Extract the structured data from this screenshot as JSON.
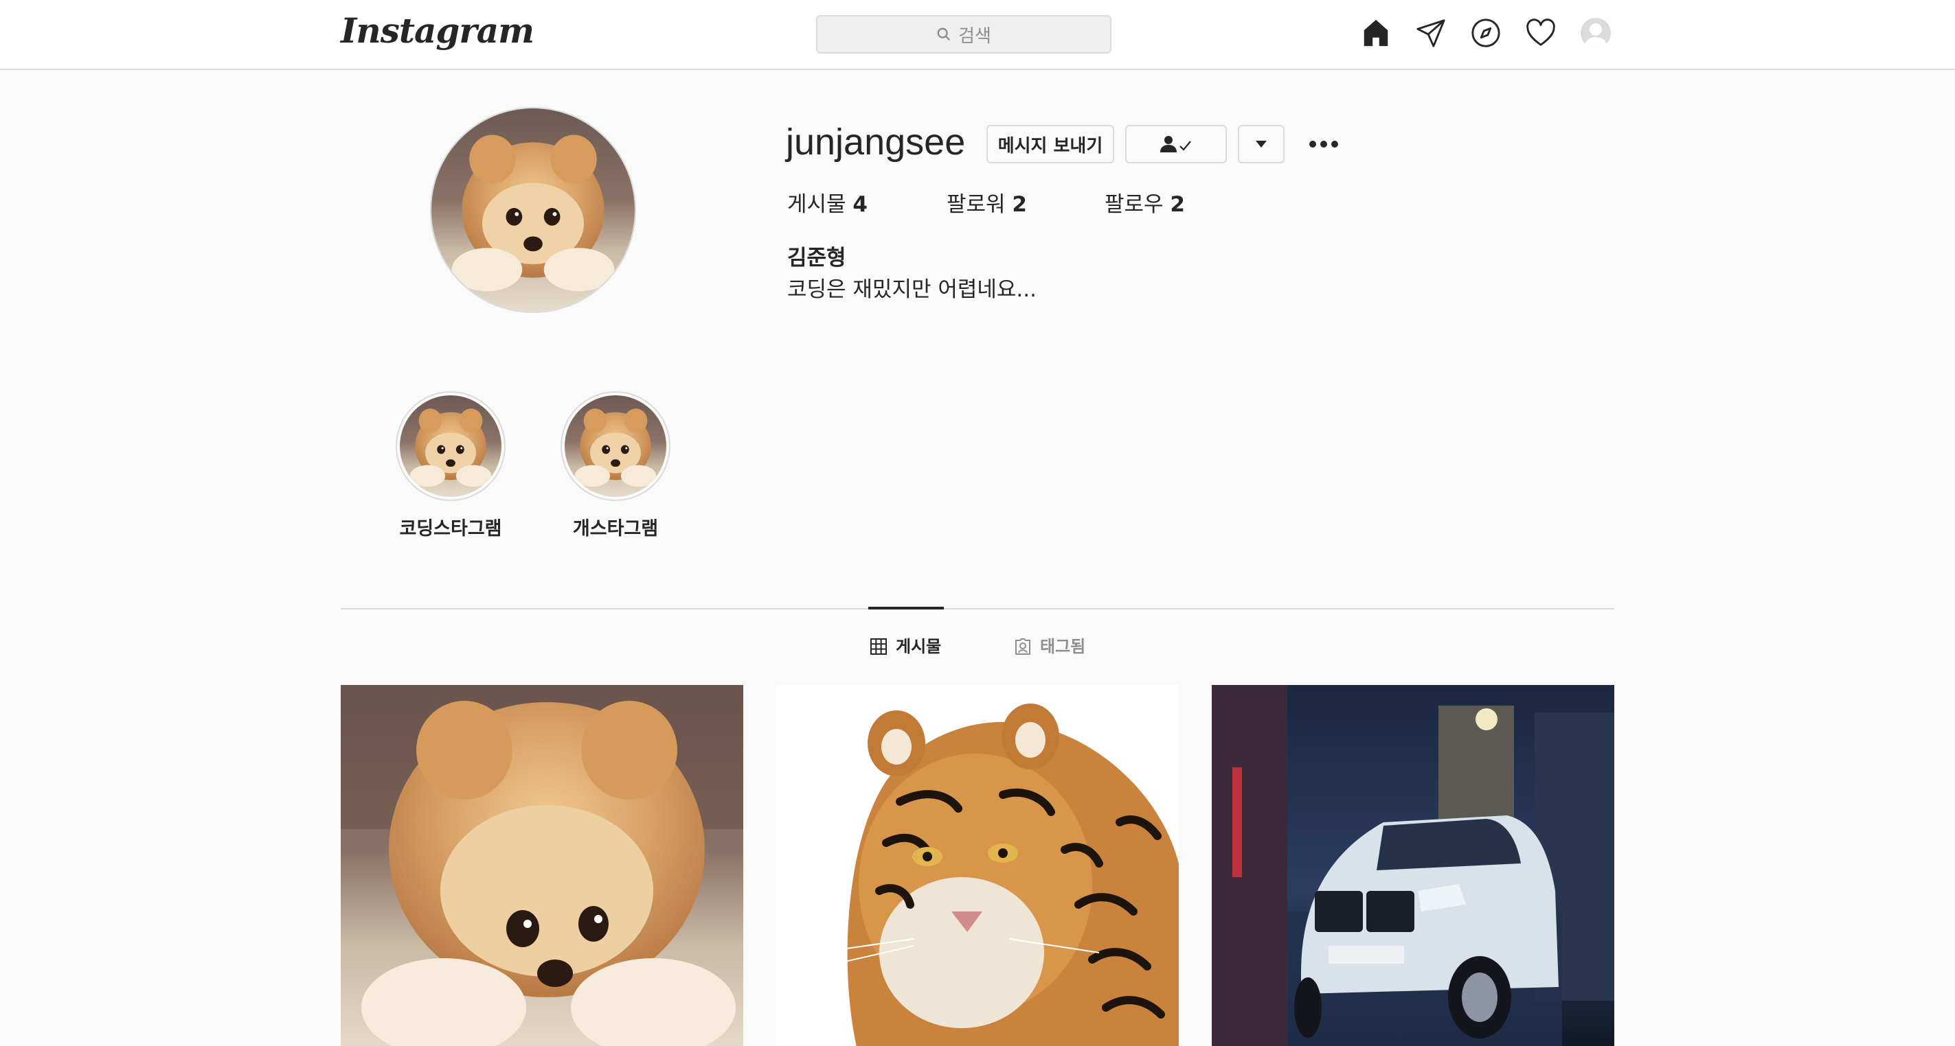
{
  "nav": {
    "logo": "Instagram",
    "search_placeholder": "검색",
    "icons": [
      "home-icon",
      "direct-icon",
      "explore-icon",
      "activity-heart-icon",
      "profile-avatar-icon"
    ]
  },
  "profile": {
    "username": "junjangsee",
    "message_button": "메시지 보내기",
    "follow_state_icon": "person-check-icon",
    "suggest_icon": "caret-down-icon",
    "options_icon": "more-dots-icon",
    "stats": {
      "posts_label": "게시물",
      "posts_count": "4",
      "followers_label": "팔로워",
      "followers_count": "2",
      "following_label": "팔로우",
      "following_count": "2"
    },
    "full_name": "김준형",
    "bio": "코딩은 재밌지만 어렵네요..."
  },
  "highlights": [
    {
      "label": "코딩스타그램"
    },
    {
      "label": "개스타그램"
    }
  ],
  "tabs": [
    {
      "label": "게시물",
      "icon": "grid-icon",
      "active": true
    },
    {
      "label": "태그됨",
      "icon": "tagged-icon",
      "active": false
    }
  ],
  "posts": [
    {
      "subject": "pomeranian-dog"
    },
    {
      "subject": "tiger"
    },
    {
      "subject": "suv-car"
    }
  ],
  "colors": {
    "background": "#fafafa",
    "border": "#dbdbdb",
    "text": "#262626",
    "muted": "#8e8e8e"
  }
}
